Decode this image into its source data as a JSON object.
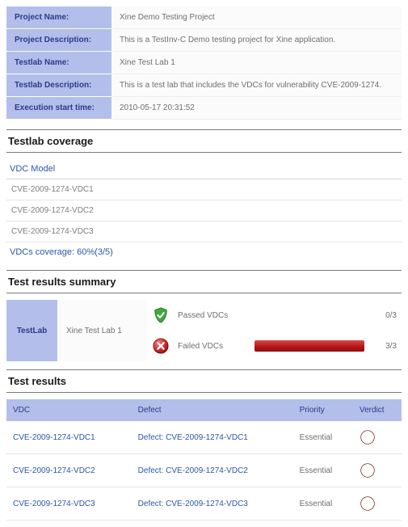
{
  "info": {
    "project_name_label": "Project Name:",
    "project_name": "Xine Demo Testing Project",
    "project_desc_label": "Project Description:",
    "project_desc": "This is a TestInv-C Demo testing project for Xine application.",
    "testlab_name_label": "Testlab Name:",
    "testlab_name": "Xine Test Lab 1",
    "testlab_desc_label": "Testlab Description:",
    "testlab_desc": "This is a test lab that includes the VDCs for vulnerability CVE-2009-1274.",
    "exec_time_label": "Execution start time:",
    "exec_time": "2010-05-17 20:31:52"
  },
  "coverage": {
    "title": "Testlab coverage",
    "header": "VDC Model",
    "rows": [
      "CVE-2009-1274-VDC1",
      "CVE-2009-1274-VDC2",
      "CVE-2009-1274-VDC3"
    ],
    "summary": "VDCs coverage: 60%(3/5)"
  },
  "summary": {
    "title": "Test results summary",
    "left_label": "TestLab",
    "lab_name": "Xine Test Lab 1",
    "passed_label": "Passed VDCs",
    "passed_count": "0/3",
    "failed_label": "Failed VDCs",
    "failed_count": "3/3"
  },
  "results": {
    "title": "Test results",
    "columns": {
      "vdc": "VDC",
      "defect": "Defect",
      "priority": "Priority",
      "verdict": "Verdict"
    },
    "rows": [
      {
        "vdc": "CVE-2009-1274-VDC1",
        "defect": "Defect: CVE-2009-1274-VDC1",
        "priority": "Essential"
      },
      {
        "vdc": "CVE-2009-1274-VDC2",
        "defect": "Defect: CVE-2009-1274-VDC2",
        "priority": "Essential"
      },
      {
        "vdc": "CVE-2009-1274-VDC3",
        "defect": "Defect: CVE-2009-1274-VDC3",
        "priority": "Essential"
      }
    ]
  }
}
